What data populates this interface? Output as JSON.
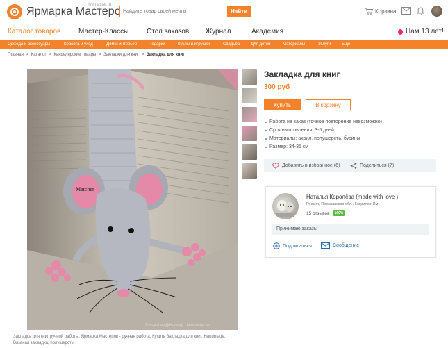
{
  "header": {
    "logo_text": "Ярмарка Мастеров",
    "logo_subtext": "livemaster.ru",
    "search_placeholder": "Найдите товар своей мечты",
    "search_button": "Найти",
    "cart_label": "Корзина",
    "icons": [
      "cart-icon",
      "mail-icon",
      "bell-icon",
      "user-avatar"
    ]
  },
  "main_nav": {
    "items": [
      "Каталог товаров",
      "Мастер-Классы",
      "Стол заказов",
      "Журнал",
      "Академия"
    ],
    "active_index": 0,
    "promo": "Нам 13 лет!"
  },
  "sub_nav": {
    "items": [
      "Одежда и аксессуары",
      "Красота и уход",
      "Дом и интерьер",
      "Подарки",
      "Куклы и игрушки",
      "Свадьба",
      "Для детей",
      "Материалы",
      "Услуги",
      "Еще"
    ]
  },
  "breadcrumbs": {
    "items": [
      "Главная",
      "Каталог",
      "Канцелярские товары",
      "Закладки для книг"
    ],
    "separator": ">",
    "current": "Закладка для книг"
  },
  "product": {
    "title": "Закладка для книг",
    "price": "300 руб",
    "buy_button": "Купить",
    "cart_button": "В корзину",
    "photo_watermark_author": "Matcher",
    "photo_watermark_site": "© ssa tcan@Hand@ Livemaster.ru",
    "specs": [
      "Работа на заказ  (точное повторение невозможно)",
      "Срок изготовления: 3-5 дней",
      "Материалы:  акрил, полушерсть, бусины",
      "Размер: 34-35 см"
    ],
    "favorite_label": "Добавить в избранное (6)",
    "share_label": "Поделиться (7)",
    "caption": "Закладка для книг ручной работы. Ярмарка Мастеров - ручная работа. Купить Закладка для книг. Handmade. Вязаная закладка, полушерсть"
  },
  "seller": {
    "name": "Наталья Королёва (made with love )",
    "location": "Россия, Ярославская обл., Гаврилов-Ям",
    "reviews": "15 отзывов",
    "rating": "100%",
    "orders_note": "Принимаю заказы",
    "subscribe_label": "Подписаться",
    "message_label": "Сообщение"
  },
  "colors": {
    "accent": "#f4822a",
    "link": "#2e6fa9",
    "rating_green": "#5eb944",
    "panel": "#eef4f6"
  }
}
